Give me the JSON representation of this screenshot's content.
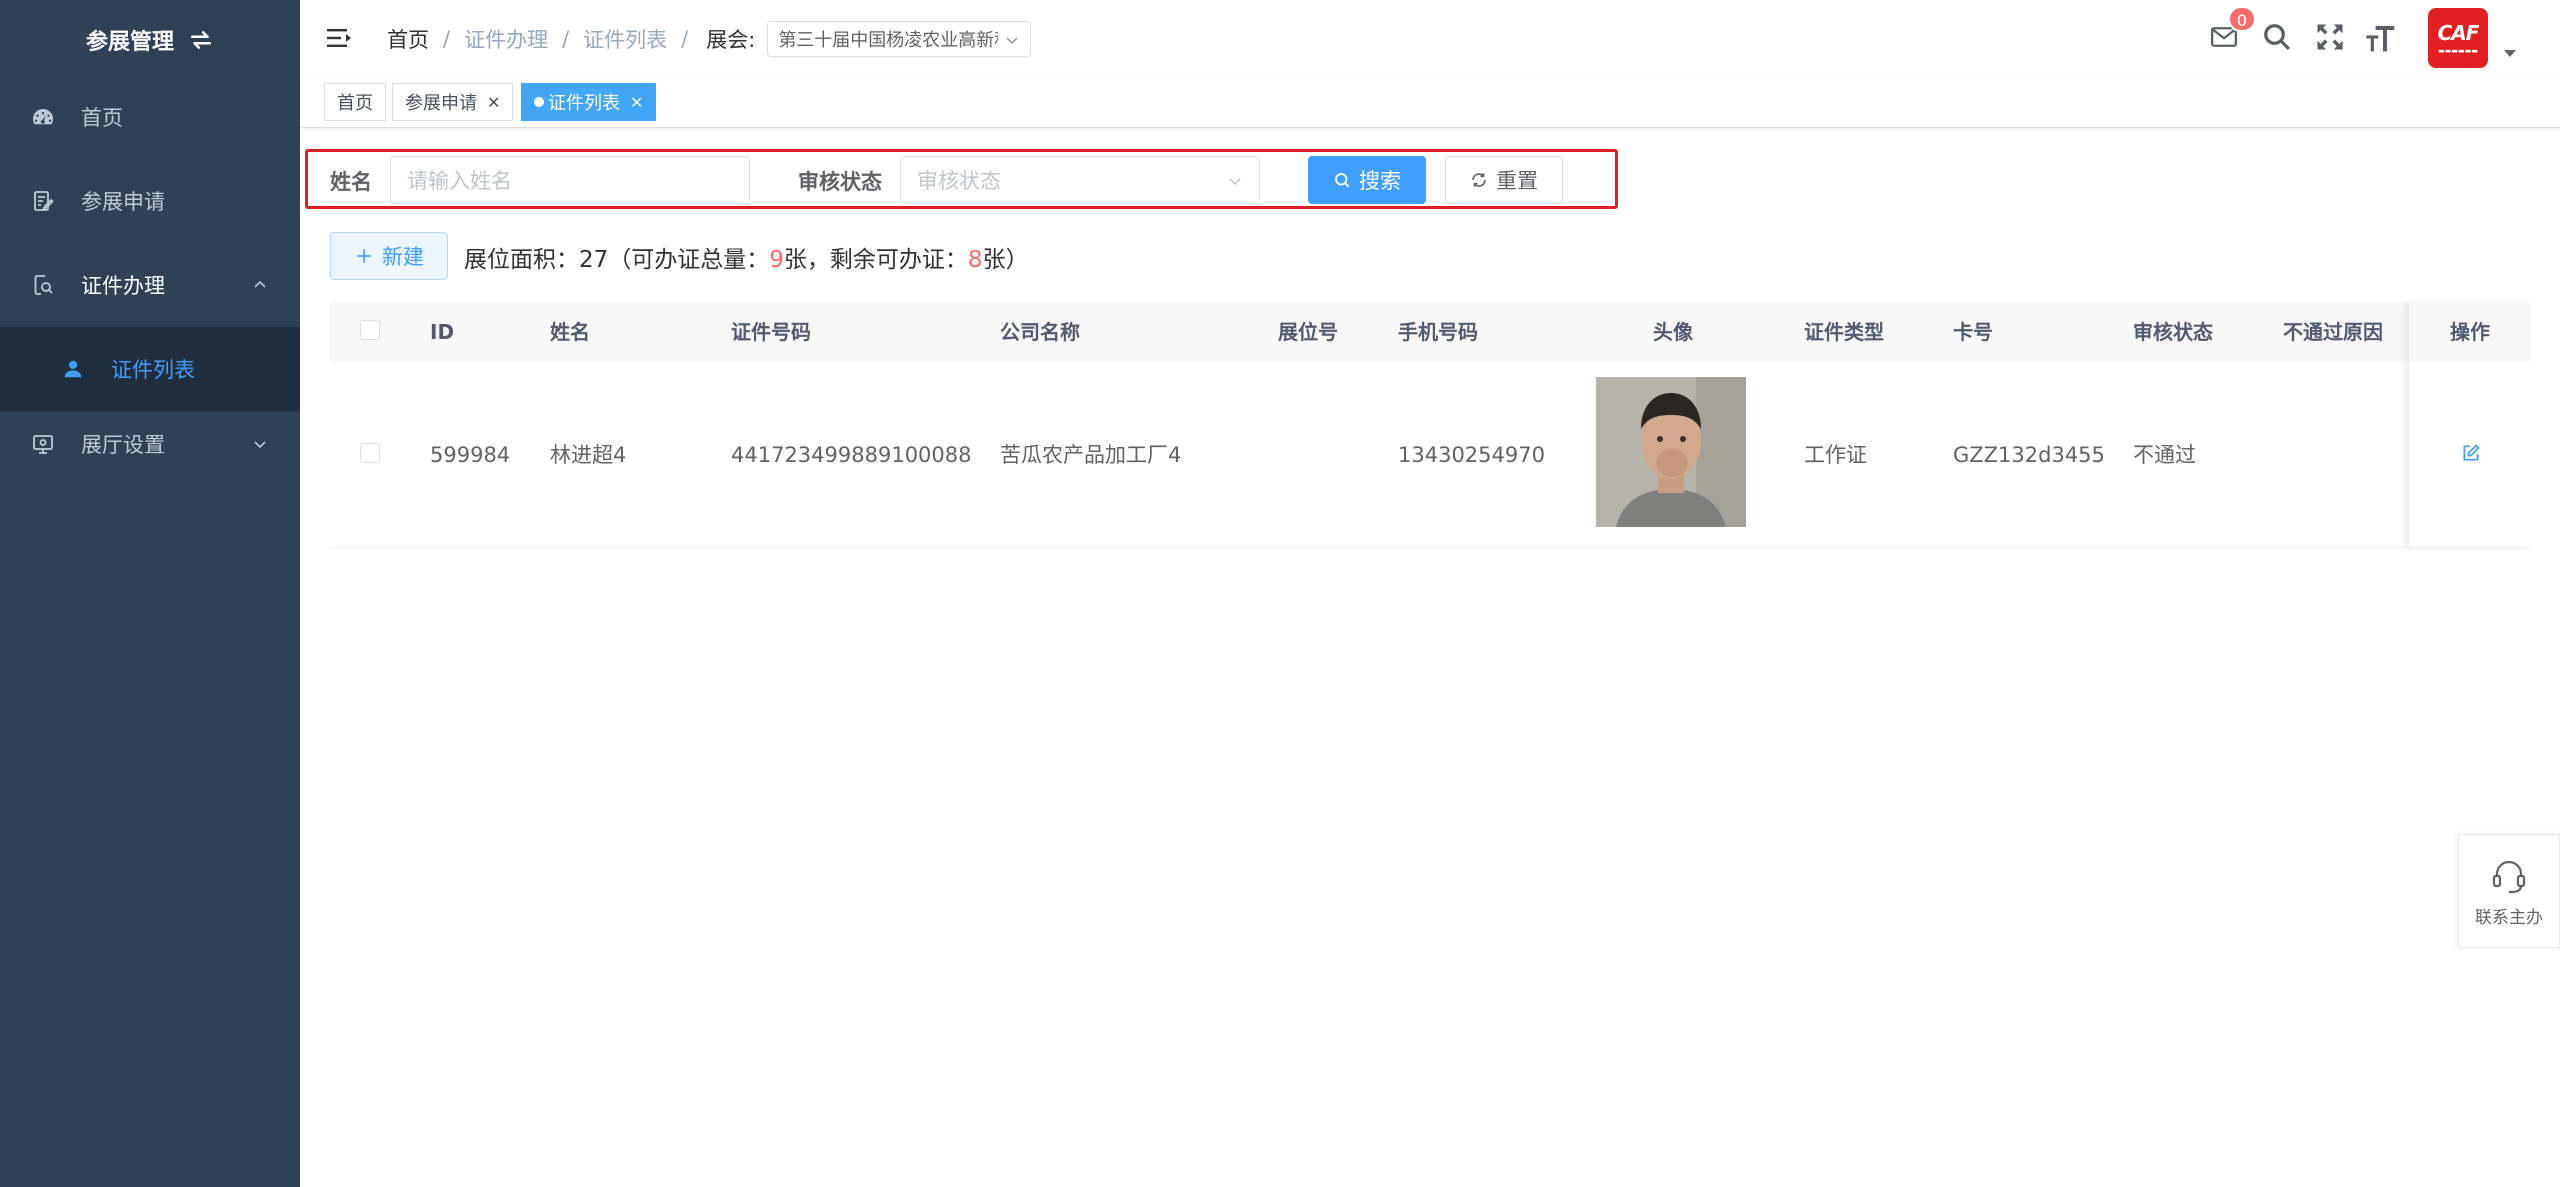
{
  "sidebar": {
    "title": "参展管理",
    "items": [
      {
        "label": "首页",
        "icon": "dashboard-icon"
      },
      {
        "label": "参展申请",
        "icon": "edit-document-icon"
      },
      {
        "label": "证件办理",
        "icon": "search-document-icon",
        "expanded": true
      },
      {
        "label": "证件列表",
        "icon": "user-icon",
        "active": true
      },
      {
        "label": "展厅设置",
        "icon": "monitor-icon"
      }
    ]
  },
  "navbar": {
    "breadcrumb": [
      "首页",
      "证件办理",
      "证件列表"
    ],
    "expo_label": "展会:",
    "expo_value": "第三十届中国杨凌农业高新科技成果博览会",
    "mail_badge": "0",
    "logo_text": "CAF",
    "accent": "#409eff"
  },
  "tags": [
    {
      "label": "首页"
    },
    {
      "label": "参展申请"
    },
    {
      "label": "证件列表",
      "active": true
    }
  ],
  "search": {
    "name_label": "姓名",
    "name_placeholder": "请输入姓名",
    "status_label": "审核状态",
    "status_placeholder": "审核状态",
    "search_button": "搜索",
    "reset_button": "重置"
  },
  "toolbar": {
    "new_button": "新建",
    "summary_prefix": "展位面积：27（可办证总量：",
    "total": "9",
    "summary_mid": "张，剩余可办证：",
    "remaining": "8",
    "summary_suffix": "张）"
  },
  "table": {
    "headers": [
      "ID",
      "姓名",
      "证件号码",
      "公司名称",
      "展位号",
      "手机号码",
      "头像",
      "证件类型",
      "卡号",
      "审核状态",
      "不通过原因",
      "操作"
    ],
    "rows": [
      {
        "id": "599984",
        "name": "林进超4",
        "cert_no": "441723499889100088",
        "company": "苦瓜农产品加工厂4",
        "booth": "",
        "phone": "13430254970",
        "cert_type": "工作证",
        "card_no": "GZZ132d3455",
        "status": "不通过",
        "reason": ""
      }
    ]
  },
  "contact": {
    "label": "联系主办"
  }
}
